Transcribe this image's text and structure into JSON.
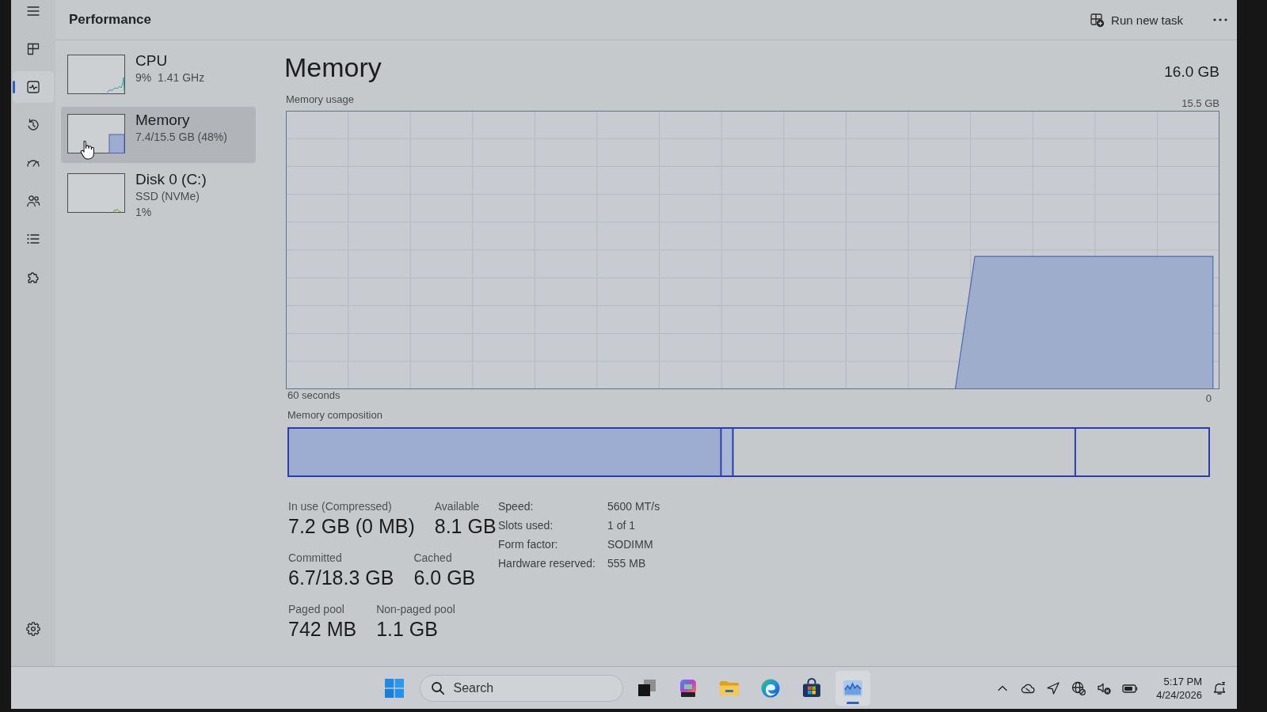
{
  "window": {
    "title": "Performance"
  },
  "toolbar": {
    "run_task": {
      "label": "Run new task"
    }
  },
  "nav": {
    "items": [
      {
        "kind": "processes",
        "selected": false
      },
      {
        "kind": "performance",
        "selected": true
      },
      {
        "kind": "history",
        "selected": false
      },
      {
        "kind": "startup",
        "selected": false
      },
      {
        "kind": "users",
        "selected": false
      },
      {
        "kind": "details",
        "selected": false
      },
      {
        "kind": "services",
        "selected": false
      }
    ]
  },
  "resources": [
    {
      "kind": "cpu",
      "name": "CPU",
      "lines": [
        "9%  1.41 GHz"
      ],
      "selected": false
    },
    {
      "kind": "memory",
      "name": "Memory",
      "lines": [
        "7.4/15.5 GB (48%)"
      ],
      "selected": true
    },
    {
      "kind": "disk",
      "name": "Disk 0 (C:)",
      "lines": [
        "SSD (NVMe)",
        "1%"
      ],
      "selected": false
    }
  ],
  "detail": {
    "title": "Memory",
    "total": "16.0 GB",
    "usage": {
      "label": "Memory usage",
      "max": "15.5 GB",
      "span": "60 seconds",
      "min": "0"
    },
    "composition": {
      "label": "Memory composition"
    },
    "stats": [
      [
        {
          "label": "In use (Compressed)",
          "value": "7.2 GB (0 MB)"
        },
        {
          "label": "Available",
          "value": "8.1 GB"
        }
      ],
      [
        {
          "label": "Committed",
          "value": "6.7/18.3 GB"
        },
        {
          "label": "Cached",
          "value": "6.0 GB"
        }
      ],
      [
        {
          "label": "Paged pool",
          "value": "742 MB"
        },
        {
          "label": "Non-paged pool",
          "value": "1.1 GB"
        }
      ]
    ],
    "specs": [
      {
        "label": "Speed:",
        "value": "5600 MT/s"
      },
      {
        "label": "Slots used:",
        "value": "1 of 1"
      },
      {
        "label": "Form factor:",
        "value": "SODIMM"
      },
      {
        "label": "Hardware reserved:",
        "value": "555 MB"
      }
    ]
  },
  "taskbar": {
    "search": {
      "placeholder": "Search"
    },
    "apps": [
      {
        "kind": "task_view",
        "active": false
      },
      {
        "kind": "office",
        "active": false
      },
      {
        "kind": "folder",
        "active": false
      },
      {
        "kind": "browser",
        "active": false
      },
      {
        "kind": "store",
        "active": false
      },
      {
        "kind": "monitor",
        "active": true
      }
    ],
    "clock": {
      "time": "5:17 PM",
      "date": "4/24/2026"
    }
  }
}
